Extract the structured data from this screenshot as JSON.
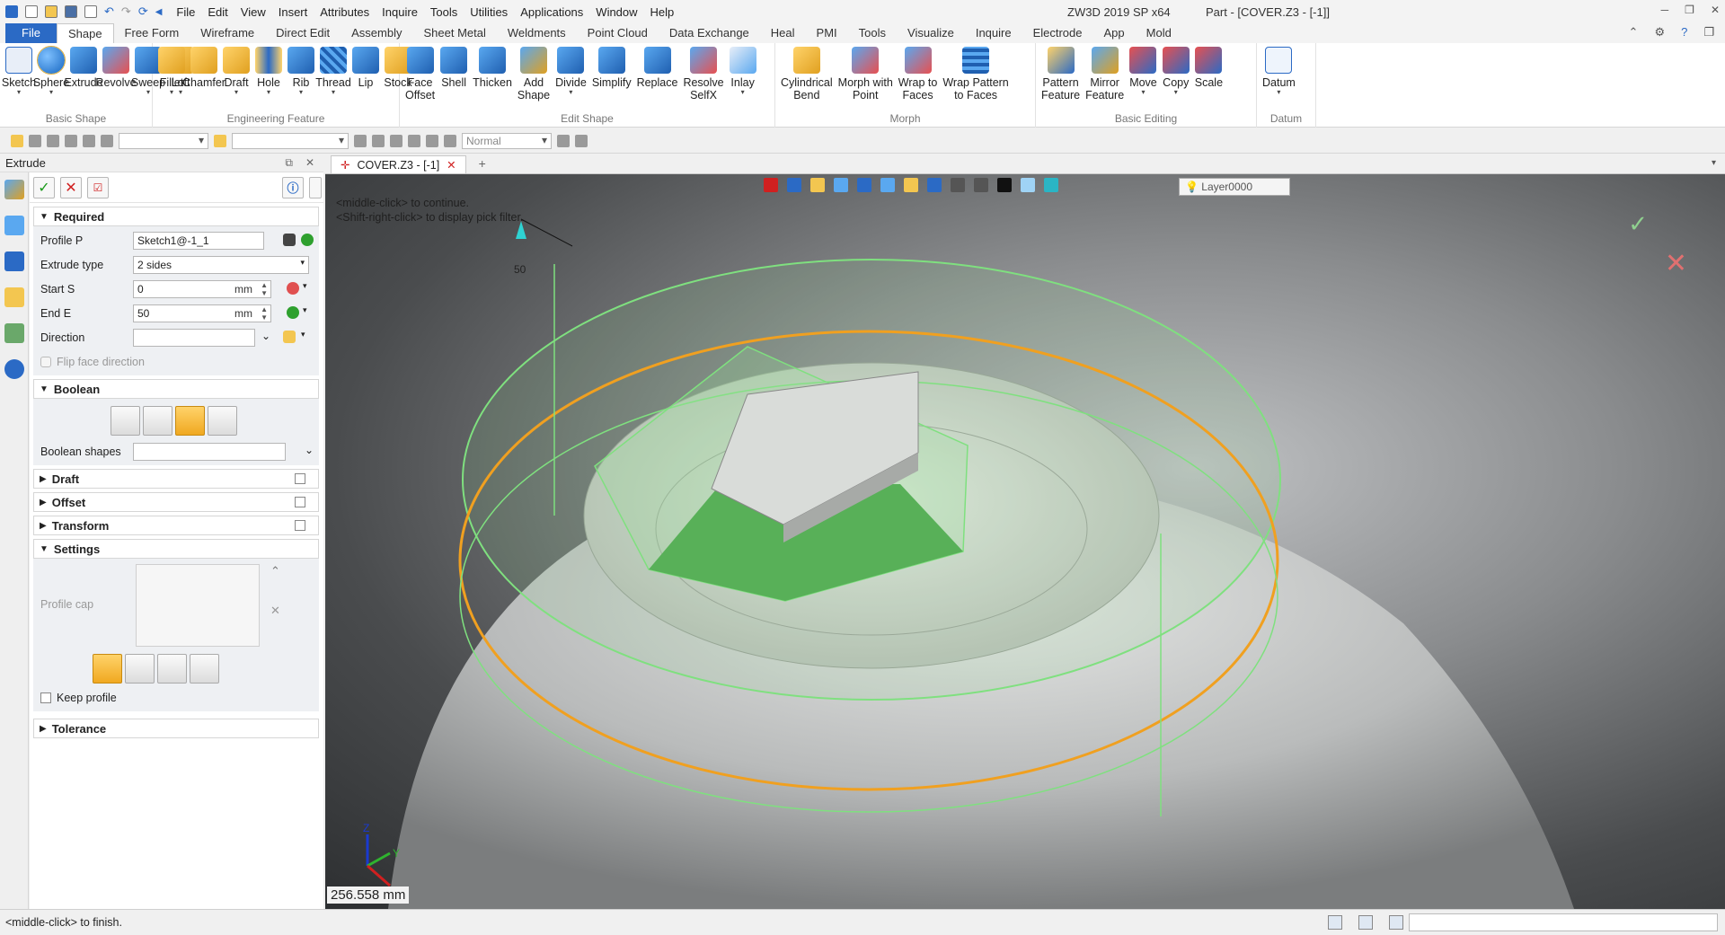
{
  "title_bar": {
    "app_name": "ZW3D 2019 SP x64",
    "document": "Part - [COVER.Z3 - [-1]]",
    "menus": [
      "File",
      "Edit",
      "View",
      "Insert",
      "Attributes",
      "Inquire",
      "Tools",
      "Utilities",
      "Applications",
      "Window",
      "Help"
    ]
  },
  "ribbon_tabs": [
    "File",
    "Shape",
    "Free Form",
    "Wireframe",
    "Direct Edit",
    "Assembly",
    "Sheet Metal",
    "Weldments",
    "Point Cloud",
    "Data Exchange",
    "Heal",
    "PMI",
    "Tools",
    "Visualize",
    "Inquire",
    "Electrode",
    "App",
    "Mold"
  ],
  "active_tab": "Shape",
  "ribbon": {
    "basic_shape": {
      "title": "Basic Shape",
      "tools": [
        "Sketch",
        "Sphere",
        "Extrude",
        "Revolve",
        "Sweep",
        "Loft"
      ]
    },
    "engineering_feature": {
      "title": "Engineering Feature",
      "tools": [
        "Fillet",
        "Chamfer",
        "Draft",
        "Hole",
        "Rib",
        "Thread",
        "Lip",
        "Stock"
      ]
    },
    "edit_shape": {
      "title": "Edit Shape",
      "tools": [
        "Face\nOffset",
        "Shell",
        "Thicken",
        "Add\nShape",
        "Divide",
        "Simplify",
        "Replace",
        "Resolve\nSelfX",
        "Inlay"
      ]
    },
    "morph": {
      "title": "Morph",
      "tools": [
        "Cylindrical\nBend",
        "Morph with\nPoint",
        "Wrap to\nFaces",
        "Wrap Pattern\nto Faces"
      ]
    },
    "basic_editing": {
      "title": "Basic Editing",
      "tools": [
        "Pattern\nFeature",
        "Mirror\nFeature",
        "Move",
        "Copy",
        "Scale"
      ]
    },
    "datum": {
      "title": "Datum",
      "tools": [
        "Datum"
      ]
    }
  },
  "toolbar2": {
    "render_mode": "Normal"
  },
  "left_panel": {
    "title": "Extrude",
    "required": {
      "header": "Required",
      "profile_label": "Profile P",
      "profile_value": "Sketch1@-1_1",
      "extrude_type_label": "Extrude type",
      "extrude_type_value": "2 sides",
      "start_label": "Start S",
      "start_value": "0",
      "end_label": "End E",
      "end_value": "50",
      "unit": "mm",
      "direction_label": "Direction",
      "flip_label": "Flip face direction"
    },
    "boolean": {
      "header": "Boolean",
      "shapes_label": "Boolean shapes"
    },
    "draft_header": "Draft",
    "offset_header": "Offset",
    "transform_header": "Transform",
    "settings": {
      "header": "Settings",
      "profile_cap_label": "Profile cap",
      "keep_profile_label": "Keep profile"
    },
    "tolerance_header": "Tolerance"
  },
  "doc_tab": {
    "label": "COVER.Z3 - [-1]"
  },
  "viewport": {
    "prompt_line1": "<middle-click> to continue.",
    "prompt_line2": "<Shift-right-click> to display pick filter.",
    "layer": "Layer0000",
    "distance": "256.558 mm",
    "dim_label": "50",
    "axis_x": "X",
    "axis_y": "Y",
    "axis_z": "Z"
  },
  "status_bar": {
    "text": "<middle-click> to finish."
  },
  "colors": {
    "accent_blue": "#2b6ac5",
    "preview_green": "#7fe07f",
    "profile_orange": "#f0a020"
  }
}
